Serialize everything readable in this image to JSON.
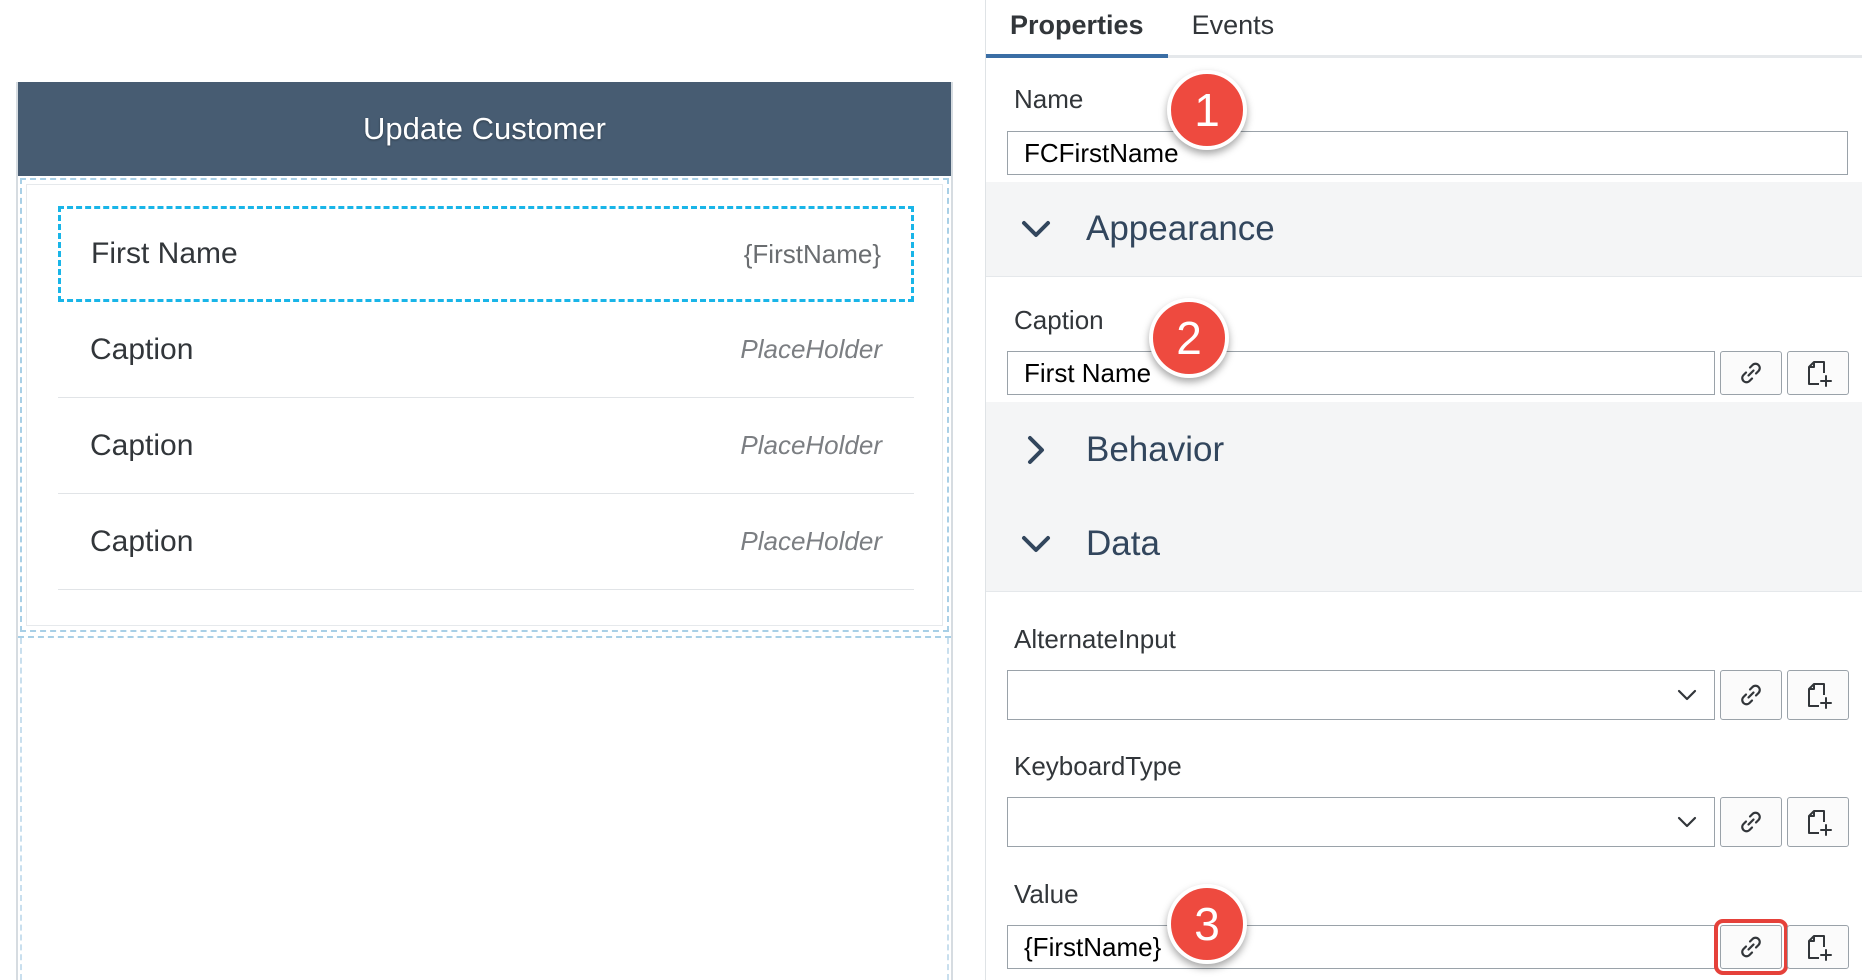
{
  "preview": {
    "header_title": "Update Customer",
    "cells": [
      {
        "caption": "First Name",
        "value": "{FirstName}",
        "selected": true,
        "placeholder": false
      },
      {
        "caption": "Caption",
        "value": "PlaceHolder",
        "selected": false,
        "placeholder": true
      },
      {
        "caption": "Caption",
        "value": "PlaceHolder",
        "selected": false,
        "placeholder": true
      },
      {
        "caption": "Caption",
        "value": "PlaceHolder",
        "selected": false,
        "placeholder": true
      }
    ]
  },
  "panel": {
    "tabs": [
      {
        "label": "Properties",
        "active": true
      },
      {
        "label": "Events",
        "active": false
      }
    ],
    "name": {
      "label": "Name",
      "value": "FCFirstName"
    },
    "appearance": {
      "title": "Appearance",
      "expanded": true
    },
    "caption": {
      "label": "Caption",
      "value": "First Name"
    },
    "behavior": {
      "title": "Behavior",
      "expanded": false
    },
    "data": {
      "title": "Data",
      "expanded": true
    },
    "alternate_input": {
      "label": "AlternateInput",
      "value": ""
    },
    "keyboard_type": {
      "label": "KeyboardType",
      "value": ""
    },
    "value": {
      "label": "Value",
      "value": "{FirstName}"
    }
  },
  "callouts": [
    "1",
    "2",
    "3"
  ],
  "colors": {
    "header_bg": "#475c72",
    "selection": "#19b5e8",
    "callout": "#ee4a3f",
    "highlight": "#e5413a",
    "tab_accent": "#3a6ea5"
  },
  "icons": {
    "link": "link-icon",
    "new_file": "new-file-icon",
    "chevron_down": "chevron-down-icon",
    "chevron_right": "chevron-right-icon"
  }
}
